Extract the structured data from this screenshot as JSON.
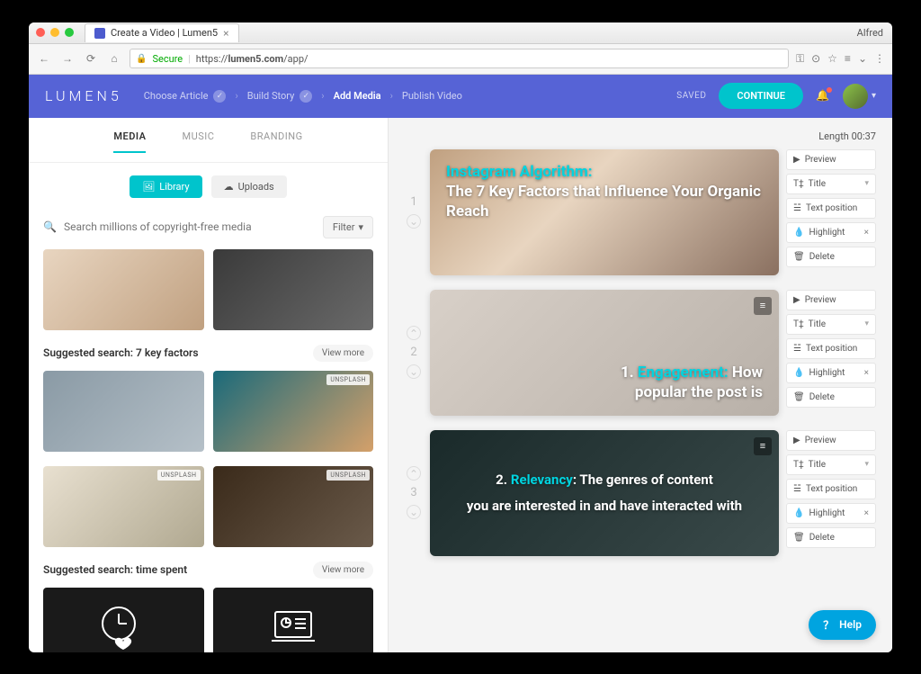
{
  "browser": {
    "tab_title": "Create a Video | Lumen5",
    "profile": "Alfred",
    "secure_label": "Secure",
    "url_prefix": "https://",
    "url_host": "lumen5.com",
    "url_path": "/app/"
  },
  "header": {
    "logo": "LUMEN5",
    "steps": {
      "s1": "Choose Article",
      "s2": "Build Story",
      "s3": "Add Media",
      "s4": "Publish Video"
    },
    "saved": "SAVED",
    "continue": "CONTINUE"
  },
  "tabs": {
    "media": "MEDIA",
    "music": "MUSIC",
    "branding": "BRANDING"
  },
  "subtabs": {
    "library": "Library",
    "uploads": "Uploads"
  },
  "search": {
    "placeholder": "Search millions of copyright-free media",
    "filter": "Filter"
  },
  "sections": {
    "s1_title": "Suggested search: 7 key factors",
    "s2_title": "Suggested search: time spent",
    "viewmore": "View more",
    "unsplash": "UNSPLASH"
  },
  "right": {
    "length_label": "Length",
    "length_value": "00:37"
  },
  "controls": {
    "preview": "Preview",
    "title": "Title",
    "textpos": "Text position",
    "highlight": "Highlight",
    "delete": "Delete"
  },
  "scenes": {
    "s1": {
      "num": "1",
      "line1_hl": "Instagram Algorithm:",
      "line2": "The 7 Key Factors that Influence Your Organic Reach"
    },
    "s2": {
      "num": "2",
      "pre": "1. ",
      "hl": "Engagement:",
      "post": " How popular the post is"
    },
    "s3": {
      "num": "3",
      "pre": "2. ",
      "hl": "Relevancy",
      "post": ": The genres of content",
      "line2": "you are interested in and have interacted with"
    }
  },
  "help": "Help"
}
